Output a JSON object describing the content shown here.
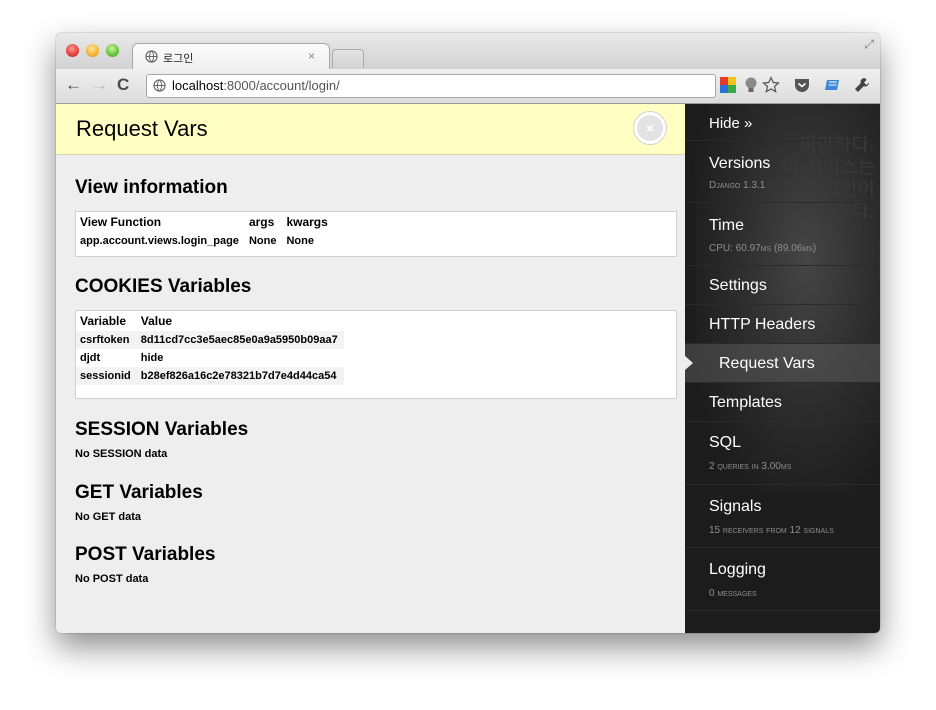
{
  "browser": {
    "tab_title": "로그인",
    "tab_close": "×",
    "url_host": "localhost",
    "url_rest": ":8000/account/login/",
    "resize_glyph": "⤢"
  },
  "panel": {
    "title": "Request Vars",
    "close_glyph": "×",
    "view_information": {
      "heading": "View information",
      "headers": [
        "View Function",
        "args",
        "kwargs"
      ],
      "row": [
        "app.account.views.login_page",
        "None",
        "None"
      ]
    },
    "cookies": {
      "heading": "COOKIES Variables",
      "headers": [
        "Variable",
        "Value"
      ],
      "rows": [
        [
          "csrftoken",
          "8d11cd7cc3e5aec85e0a9a5950b09aa7"
        ],
        [
          "djdt",
          "hide"
        ],
        [
          "sessionid",
          "b28ef826a16c2e78321b7d7e4d44ca54"
        ]
      ]
    },
    "session": {
      "heading": "SESSION Variables",
      "empty": "No SESSION data"
    },
    "get": {
      "heading": "GET Variables",
      "empty": "No GET data"
    },
    "post": {
      "heading": "POST Variables",
      "empty": "No POST data"
    }
  },
  "sidebar": {
    "hide_label": "Hide »",
    "items": [
      {
        "title": "Versions",
        "sub": "Django 1.3.1"
      },
      {
        "title": "Time",
        "sub": "CPU: 60.97ms (89.06ms)"
      },
      {
        "title": "Settings",
        "sub": ""
      },
      {
        "title": "HTTP Headers",
        "sub": ""
      },
      {
        "title": "Request Vars",
        "sub": ""
      },
      {
        "title": "Templates",
        "sub": ""
      },
      {
        "title": "SQL",
        "sub": "2 queries in 3.00ms"
      },
      {
        "title": "Signals",
        "sub": "15 receivers from 12 signals"
      },
      {
        "title": "Logging",
        "sub": "0 messages"
      }
    ],
    "background_text": "미안하다.\n이 서비스는\n로그인이\n필수다."
  }
}
